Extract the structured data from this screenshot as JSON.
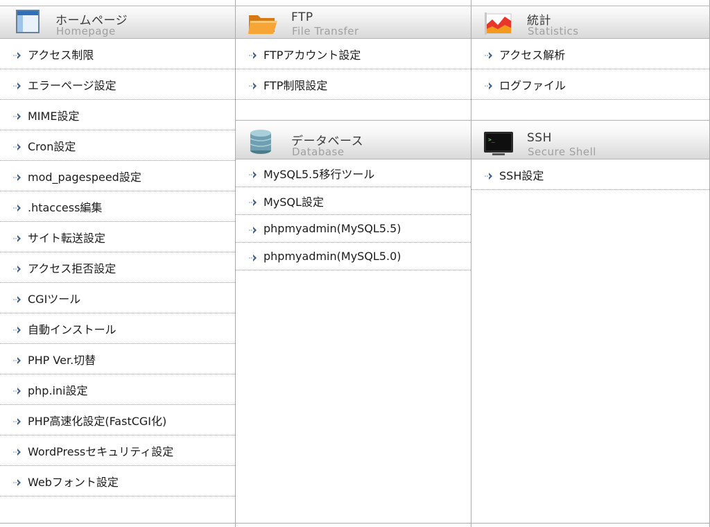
{
  "sections": {
    "homepage": {
      "title_ja": "ホームページ",
      "title_en": "Homepage",
      "items": [
        "アクセス制限",
        "エラーページ設定",
        "MIME設定",
        "Cron設定",
        "mod_pagespeed設定",
        ".htaccess編集",
        "サイト転送設定",
        "アクセス拒否設定",
        "CGIツール",
        "自動インストール",
        "PHP Ver.切替",
        "php.ini設定",
        "PHP高速化設定(FastCGI化)",
        "WordPressセキュリティ設定",
        "Webフォント設定"
      ]
    },
    "ftp": {
      "title_ja": "FTP",
      "title_en": "File Transfer",
      "items": [
        "FTPアカウント設定",
        "FTP制限設定"
      ]
    },
    "database": {
      "title_ja": "データベース",
      "title_en": "Database",
      "items": [
        "MySQL5.5移行ツール",
        "MySQL設定",
        "phpmyadmin(MySQL5.5)",
        "phpmyadmin(MySQL5.0)"
      ]
    },
    "statistics": {
      "title_ja": "統計",
      "title_en": "Statistics",
      "items": [
        "アクセス解析",
        "ログファイル"
      ]
    },
    "ssh": {
      "title_ja": "SSH",
      "title_en": "Secure Shell",
      "items": [
        "SSH設定"
      ]
    }
  },
  "icons": {
    "homepage": "browser-window-icon",
    "ftp": "folder-icon",
    "database": "database-icon",
    "statistics": "chart-icon",
    "ssh": "terminal-icon",
    "item": "arrow-bullet-icon"
  },
  "colors": {
    "arrow_light": "#b7cce6",
    "arrow_dark": "#3b5f8e"
  }
}
